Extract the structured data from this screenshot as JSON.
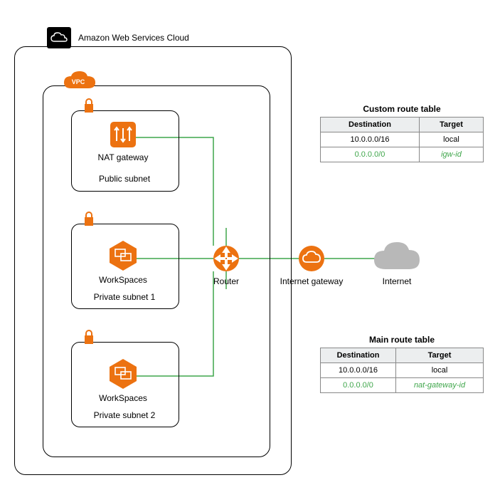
{
  "diagram": {
    "cloud_label": "Amazon Web Services Cloud",
    "vpc_label": "VPC",
    "public_subnet": {
      "nat_label": "NAT gateway",
      "subnet_label": "Public subnet"
    },
    "private_subnet_1": {
      "ws_label": "WorkSpaces",
      "subnet_label": "Private subnet 1"
    },
    "private_subnet_2": {
      "ws_label": "WorkSpaces",
      "subnet_label": "Private subnet 2"
    },
    "router_label": "Router",
    "igw_label": "Internet gateway",
    "internet_label": "Internet"
  },
  "route_tables": {
    "custom": {
      "title": "Custom route table",
      "headers": {
        "dest": "Destination",
        "target": "Target"
      },
      "rows": [
        {
          "dest": "10.0.0.0/16",
          "target": "local",
          "color": "black"
        },
        {
          "dest": "0.0.0.0/0",
          "target": "igw-id",
          "color": "green",
          "italic_target": true
        }
      ]
    },
    "main": {
      "title": "Main route table",
      "headers": {
        "dest": "Destination",
        "target": "Target"
      },
      "rows": [
        {
          "dest": "10.0.0.0/16",
          "target": "local",
          "color": "black"
        },
        {
          "dest": "0.0.0.0/0",
          "target": "nat-gateway-id",
          "color": "green",
          "italic_target": true
        }
      ]
    }
  },
  "icons": {
    "aws_cloud": "aws-cloud-icon",
    "vpc": "vpc-icon",
    "lock": "lock-icon",
    "nat": "nat-gateway-icon",
    "workspaces": "workspaces-icon",
    "router": "router-icon",
    "igw": "internet-gateway-icon",
    "internet": "internet-cloud-icon"
  },
  "colors": {
    "aws_orange": "#ec7211",
    "green_line": "#3fa64b",
    "gray_cloud": "#b8b8b8"
  }
}
